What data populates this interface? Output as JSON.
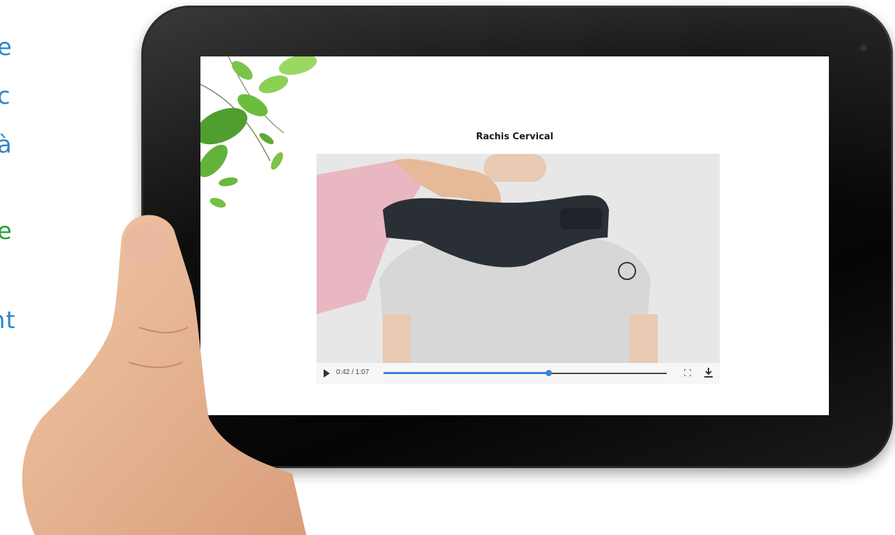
{
  "side_text": {
    "lines": [
      {
        "text": "e",
        "style": "blue"
      },
      {
        "text": "c",
        "style": "blue"
      },
      {
        "text": "à",
        "style": "blue"
      },
      {
        "text": "e",
        "style": "green"
      },
      {
        "text": "nt",
        "style": "blue"
      }
    ]
  },
  "screen": {
    "title": "Rachis Cervical",
    "video": {
      "time_label": "0:42 / 1:07",
      "progress": 0.583,
      "icons": [
        "play-icon",
        "fullscreen-icon",
        "download-icon"
      ]
    }
  },
  "colors": {
    "accent": "#3b82d8",
    "text_blue": "#2f86c8",
    "text_green": "#2e9e3c"
  }
}
